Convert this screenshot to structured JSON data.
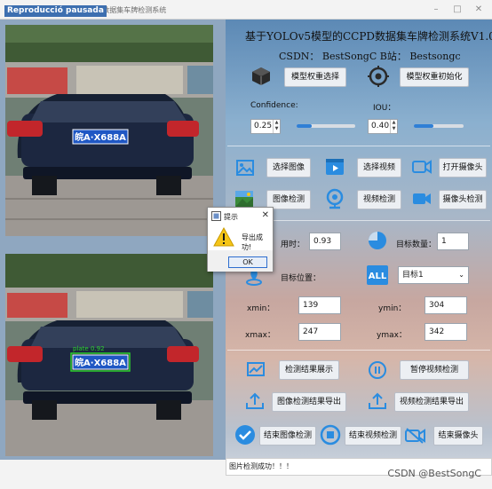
{
  "window": {
    "title": "基于YOLOv5模型的CCPD数据集车牌检测系统",
    "overlay_badge": "Reproducció pausada"
  },
  "header": {
    "app_title": "基于YOLOv5模型的CCPD数据集车牌检测系统V1.0",
    "author_line": "CSDN： BestSongC   B站： Bestsongc"
  },
  "model": {
    "select_weights": "模型权重选择",
    "init_weights": "模型权重初始化"
  },
  "params": {
    "confidence_label": "Confidence:",
    "confidence_value": "0.25",
    "confidence_level": 0.25,
    "iou_label": "IOU：",
    "iou_value": "0.40",
    "iou_level": 0.4
  },
  "actions": {
    "select_image": "选择图像",
    "select_video": "选择视频",
    "open_camera": "打开摄像头",
    "image_detect": "图像检测",
    "video_detect": "视频检测",
    "camera_detect": "摄像头检测"
  },
  "results": {
    "time_label": "用时：",
    "time_value": "0.93",
    "count_label": "目标数量：",
    "count_value": "1",
    "position_label": "目标位置：",
    "target_select": "目标1",
    "xmin_label": "xmin：",
    "xmin_value": "139",
    "ymin_label": "ymin：",
    "ymin_value": "304",
    "xmax_label": "xmax：",
    "xmax_value": "247",
    "ymax_label": "ymax：",
    "ymax_value": "342"
  },
  "bottom_actions": {
    "show_result": "检测结果展示",
    "pause_video": "暂停视频检测",
    "export_image": "图像检测结果导出",
    "export_video": "视频检测结果导出",
    "end_image": "结束图像检测",
    "end_video": "结束视频检测",
    "close_camera": "结束摄像头"
  },
  "status": {
    "message": "图片检测成功！！！"
  },
  "dialog": {
    "title": "提示",
    "message": "导出成功!",
    "ok": "OK"
  },
  "images": {
    "top_plate": "皖A·X688A",
    "bottom_plate": "皖A·X688A",
    "det_label": "plate 0.92"
  },
  "watermark": "CSDN @BestSongC",
  "colors": {
    "accent": "#2f7fd6",
    "icon_blue": "#2a8ce0",
    "warning": "#f5c518"
  }
}
